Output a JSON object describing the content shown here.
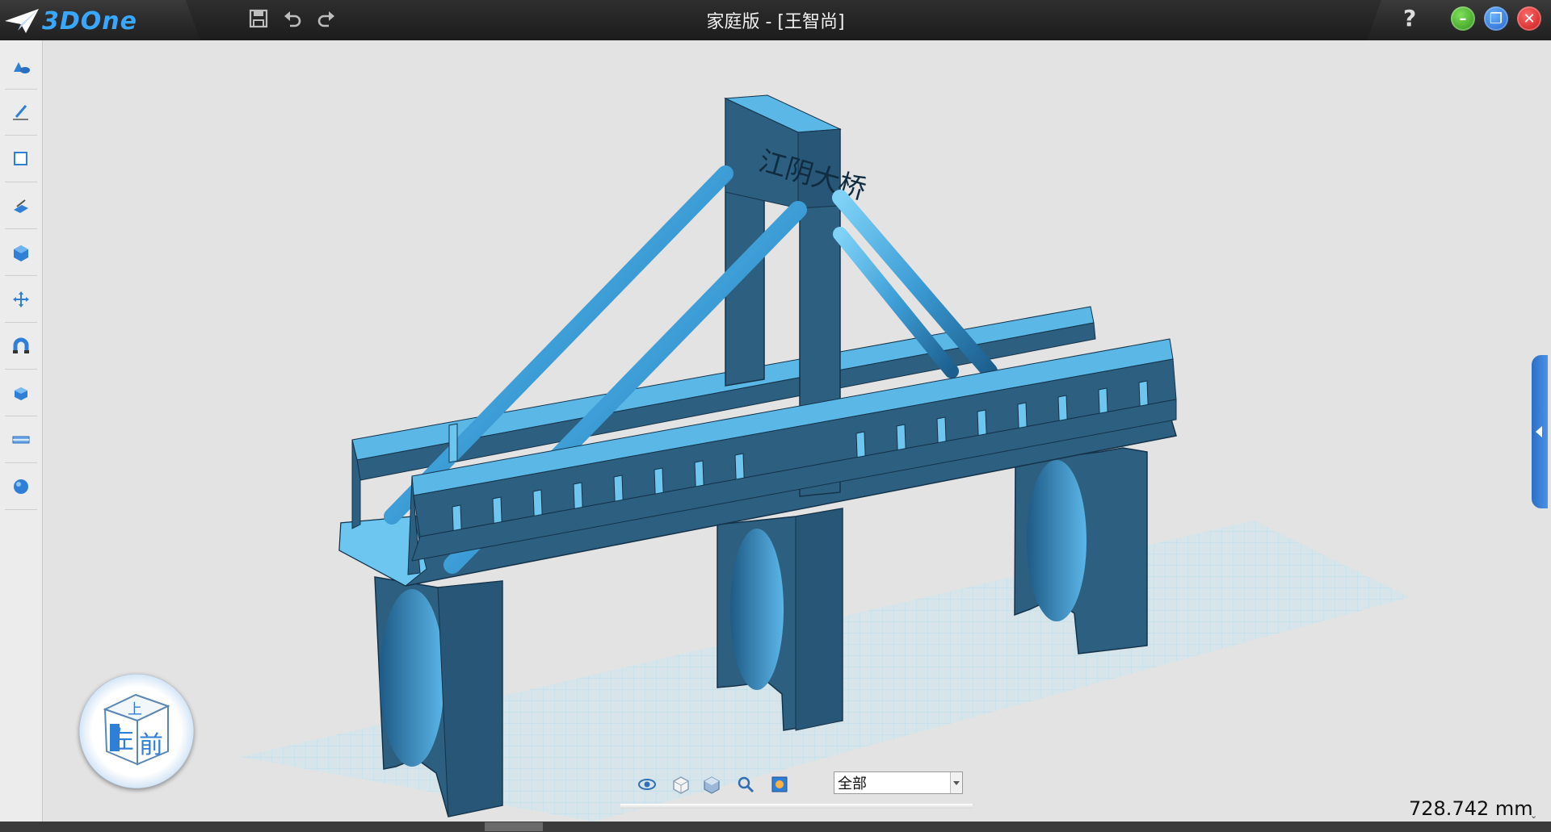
{
  "app": {
    "logo_text": "3DOne",
    "window_title": "家庭版 - [王智尚]",
    "help_label": "?",
    "accent_color": "#39a7ff",
    "model_color": "#2d5f80"
  },
  "quick_access": [
    {
      "name": "save-icon"
    },
    {
      "name": "undo-icon"
    },
    {
      "name": "redo-icon"
    }
  ],
  "left_toolbar": [
    {
      "name": "basic-solid-icon"
    },
    {
      "name": "sketch-icon"
    },
    {
      "name": "sketch-edit-icon"
    },
    {
      "name": "feature-modeling-icon"
    },
    {
      "name": "special-function-icon"
    },
    {
      "name": "basic-edit-icon"
    },
    {
      "name": "magnet-icon"
    },
    {
      "name": "combination-edit-icon"
    },
    {
      "name": "distance-measure-icon"
    },
    {
      "name": "color-render-icon"
    }
  ],
  "viewcube": {
    "top_label": "上",
    "left_label": "左",
    "front_label": "前"
  },
  "model": {
    "sign_text": "江阴大桥"
  },
  "bottom_toolbar": {
    "icons": [
      "view-icon",
      "wireframe-cube-icon",
      "solid-cube-icon",
      "zoom-icon",
      "render-icon"
    ],
    "filter_value": "全部"
  },
  "measure": {
    "value": "728.742 mm"
  }
}
